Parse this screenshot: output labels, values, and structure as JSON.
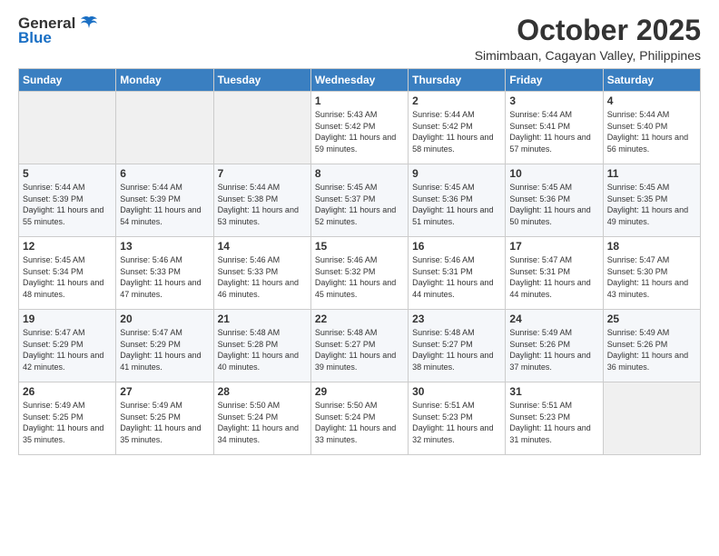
{
  "logo": {
    "general": "General",
    "blue": "Blue"
  },
  "title": "October 2025",
  "subtitle": "Simimbaan, Cagayan Valley, Philippines",
  "days_header": [
    "Sunday",
    "Monday",
    "Tuesday",
    "Wednesday",
    "Thursday",
    "Friday",
    "Saturday"
  ],
  "weeks": [
    [
      {
        "day": "",
        "sunrise": "",
        "sunset": "",
        "daylight": ""
      },
      {
        "day": "",
        "sunrise": "",
        "sunset": "",
        "daylight": ""
      },
      {
        "day": "",
        "sunrise": "",
        "sunset": "",
        "daylight": ""
      },
      {
        "day": "1",
        "sunrise": "Sunrise: 5:43 AM",
        "sunset": "Sunset: 5:42 PM",
        "daylight": "Daylight: 11 hours and 59 minutes."
      },
      {
        "day": "2",
        "sunrise": "Sunrise: 5:44 AM",
        "sunset": "Sunset: 5:42 PM",
        "daylight": "Daylight: 11 hours and 58 minutes."
      },
      {
        "day": "3",
        "sunrise": "Sunrise: 5:44 AM",
        "sunset": "Sunset: 5:41 PM",
        "daylight": "Daylight: 11 hours and 57 minutes."
      },
      {
        "day": "4",
        "sunrise": "Sunrise: 5:44 AM",
        "sunset": "Sunset: 5:40 PM",
        "daylight": "Daylight: 11 hours and 56 minutes."
      }
    ],
    [
      {
        "day": "5",
        "sunrise": "Sunrise: 5:44 AM",
        "sunset": "Sunset: 5:39 PM",
        "daylight": "Daylight: 11 hours and 55 minutes."
      },
      {
        "day": "6",
        "sunrise": "Sunrise: 5:44 AM",
        "sunset": "Sunset: 5:39 PM",
        "daylight": "Daylight: 11 hours and 54 minutes."
      },
      {
        "day": "7",
        "sunrise": "Sunrise: 5:44 AM",
        "sunset": "Sunset: 5:38 PM",
        "daylight": "Daylight: 11 hours and 53 minutes."
      },
      {
        "day": "8",
        "sunrise": "Sunrise: 5:45 AM",
        "sunset": "Sunset: 5:37 PM",
        "daylight": "Daylight: 11 hours and 52 minutes."
      },
      {
        "day": "9",
        "sunrise": "Sunrise: 5:45 AM",
        "sunset": "Sunset: 5:36 PM",
        "daylight": "Daylight: 11 hours and 51 minutes."
      },
      {
        "day": "10",
        "sunrise": "Sunrise: 5:45 AM",
        "sunset": "Sunset: 5:36 PM",
        "daylight": "Daylight: 11 hours and 50 minutes."
      },
      {
        "day": "11",
        "sunrise": "Sunrise: 5:45 AM",
        "sunset": "Sunset: 5:35 PM",
        "daylight": "Daylight: 11 hours and 49 minutes."
      }
    ],
    [
      {
        "day": "12",
        "sunrise": "Sunrise: 5:45 AM",
        "sunset": "Sunset: 5:34 PM",
        "daylight": "Daylight: 11 hours and 48 minutes."
      },
      {
        "day": "13",
        "sunrise": "Sunrise: 5:46 AM",
        "sunset": "Sunset: 5:33 PM",
        "daylight": "Daylight: 11 hours and 47 minutes."
      },
      {
        "day": "14",
        "sunrise": "Sunrise: 5:46 AM",
        "sunset": "Sunset: 5:33 PM",
        "daylight": "Daylight: 11 hours and 46 minutes."
      },
      {
        "day": "15",
        "sunrise": "Sunrise: 5:46 AM",
        "sunset": "Sunset: 5:32 PM",
        "daylight": "Daylight: 11 hours and 45 minutes."
      },
      {
        "day": "16",
        "sunrise": "Sunrise: 5:46 AM",
        "sunset": "Sunset: 5:31 PM",
        "daylight": "Daylight: 11 hours and 44 minutes."
      },
      {
        "day": "17",
        "sunrise": "Sunrise: 5:47 AM",
        "sunset": "Sunset: 5:31 PM",
        "daylight": "Daylight: 11 hours and 44 minutes."
      },
      {
        "day": "18",
        "sunrise": "Sunrise: 5:47 AM",
        "sunset": "Sunset: 5:30 PM",
        "daylight": "Daylight: 11 hours and 43 minutes."
      }
    ],
    [
      {
        "day": "19",
        "sunrise": "Sunrise: 5:47 AM",
        "sunset": "Sunset: 5:29 PM",
        "daylight": "Daylight: 11 hours and 42 minutes."
      },
      {
        "day": "20",
        "sunrise": "Sunrise: 5:47 AM",
        "sunset": "Sunset: 5:29 PM",
        "daylight": "Daylight: 11 hours and 41 minutes."
      },
      {
        "day": "21",
        "sunrise": "Sunrise: 5:48 AM",
        "sunset": "Sunset: 5:28 PM",
        "daylight": "Daylight: 11 hours and 40 minutes."
      },
      {
        "day": "22",
        "sunrise": "Sunrise: 5:48 AM",
        "sunset": "Sunset: 5:27 PM",
        "daylight": "Daylight: 11 hours and 39 minutes."
      },
      {
        "day": "23",
        "sunrise": "Sunrise: 5:48 AM",
        "sunset": "Sunset: 5:27 PM",
        "daylight": "Daylight: 11 hours and 38 minutes."
      },
      {
        "day": "24",
        "sunrise": "Sunrise: 5:49 AM",
        "sunset": "Sunset: 5:26 PM",
        "daylight": "Daylight: 11 hours and 37 minutes."
      },
      {
        "day": "25",
        "sunrise": "Sunrise: 5:49 AM",
        "sunset": "Sunset: 5:26 PM",
        "daylight": "Daylight: 11 hours and 36 minutes."
      }
    ],
    [
      {
        "day": "26",
        "sunrise": "Sunrise: 5:49 AM",
        "sunset": "Sunset: 5:25 PM",
        "daylight": "Daylight: 11 hours and 35 minutes."
      },
      {
        "day": "27",
        "sunrise": "Sunrise: 5:49 AM",
        "sunset": "Sunset: 5:25 PM",
        "daylight": "Daylight: 11 hours and 35 minutes."
      },
      {
        "day": "28",
        "sunrise": "Sunrise: 5:50 AM",
        "sunset": "Sunset: 5:24 PM",
        "daylight": "Daylight: 11 hours and 34 minutes."
      },
      {
        "day": "29",
        "sunrise": "Sunrise: 5:50 AM",
        "sunset": "Sunset: 5:24 PM",
        "daylight": "Daylight: 11 hours and 33 minutes."
      },
      {
        "day": "30",
        "sunrise": "Sunrise: 5:51 AM",
        "sunset": "Sunset: 5:23 PM",
        "daylight": "Daylight: 11 hours and 32 minutes."
      },
      {
        "day": "31",
        "sunrise": "Sunrise: 5:51 AM",
        "sunset": "Sunset: 5:23 PM",
        "daylight": "Daylight: 11 hours and 31 minutes."
      },
      {
        "day": "",
        "sunrise": "",
        "sunset": "",
        "daylight": ""
      }
    ]
  ]
}
